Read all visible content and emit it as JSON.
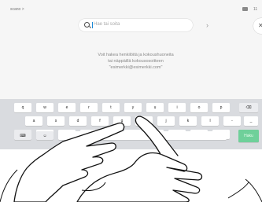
{
  "topbar": {
    "title": "scano >",
    "clock": "11"
  },
  "search": {
    "placeholder": "Hae tai soita"
  },
  "hint": {
    "line1": "Voit hakea henkilöitä ja kokoushuoneita",
    "line2": "tai näppäillä kokousosoitteen",
    "line3": "\"esimerkki@esimerkki.com\""
  },
  "keyboard": {
    "row1": [
      "q",
      "w",
      "e",
      "r",
      "t",
      "y",
      "u",
      "i",
      "o",
      "p"
    ],
    "row2": [
      "a",
      "s",
      "d",
      "f",
      "g",
      "h",
      "j",
      "k",
      "l",
      "-",
      "_"
    ],
    "row3": [
      "z",
      "x",
      "c",
      "v",
      "b",
      "n",
      "m",
      "@",
      "."
    ],
    "search_label": "Haku"
  },
  "icons": {
    "close": "close-icon",
    "next": "chevron-right-icon",
    "backspace": "backspace-icon",
    "shift": "shift-icon",
    "emoji": "emoji-icon",
    "keyboard": "keyboard-icon",
    "camera": "camera-icon"
  }
}
